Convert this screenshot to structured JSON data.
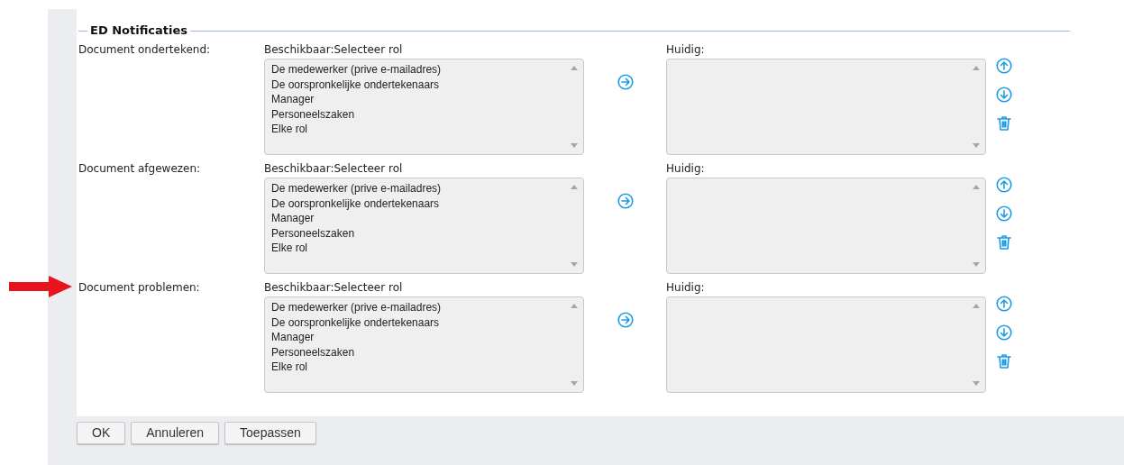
{
  "section": {
    "title": "ED Notificaties"
  },
  "rows": [
    {
      "label": "Document ondertekend:",
      "available_label": "Beschikbaar:Selecteer rol",
      "options": [
        "De medewerker (prive e-mailadres)",
        "De oorspronkelijke ondertekenaars",
        "Manager",
        "Personeelszaken",
        "Elke rol"
      ],
      "current_label": "Huidig:"
    },
    {
      "label": "Document afgewezen:",
      "available_label": "Beschikbaar:Selecteer rol",
      "options": [
        "De medewerker (prive e-mailadres)",
        "De oorspronkelijke ondertekenaars",
        "Manager",
        "Personeelszaken",
        "Elke rol"
      ],
      "current_label": "Huidig:"
    },
    {
      "label": "Document problemen:",
      "available_label": "Beschikbaar:Selecteer rol",
      "options": [
        "De medewerker (prive e-mailadres)",
        "De oorspronkelijke ondertekenaars",
        "Manager",
        "Personeelszaken",
        "Elke rol"
      ],
      "current_label": "Huidig:",
      "annotated": true
    }
  ],
  "buttons": [
    "OK",
    "Annuleren",
    "Toepassen"
  ]
}
